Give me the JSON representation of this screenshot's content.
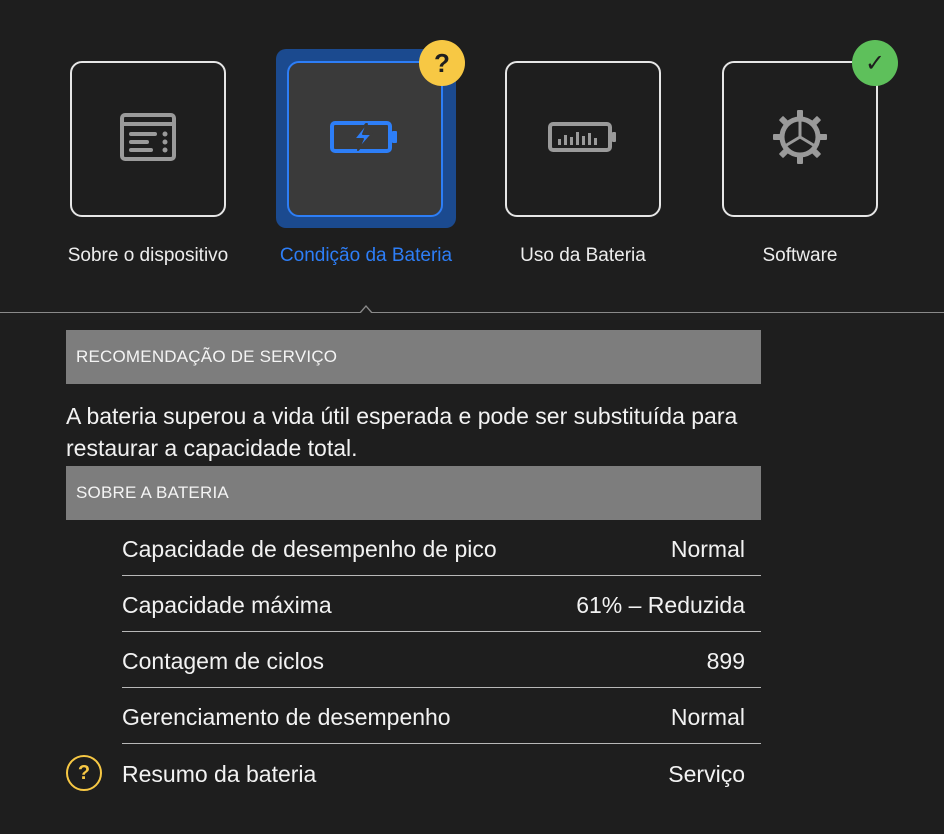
{
  "tabs": [
    {
      "label": "Sobre o dispositivo",
      "icon": "device-info-icon",
      "selected": false
    },
    {
      "label": "Condição da Bateria",
      "icon": "battery-charging-icon",
      "selected": true,
      "badge": "?"
    },
    {
      "label": "Uso da Bateria",
      "icon": "battery-usage-icon",
      "selected": false
    },
    {
      "label": "Software",
      "icon": "gear-icon",
      "selected": false,
      "badge": "✓"
    }
  ],
  "service_section": {
    "header": "RECOMENDAÇÃO DE SERVIÇO",
    "text": "A bateria superou a vida útil esperada e pode ser substituída para restaurar a capacidade total."
  },
  "battery_section": {
    "header": "SOBRE A BATERIA",
    "rows": [
      {
        "label": "Capacidade de desempenho de pico",
        "value": "Normal"
      },
      {
        "label": "Capacidade máxima",
        "value": "61% – Reduzida"
      },
      {
        "label": "Contagem de ciclos",
        "value": "899"
      },
      {
        "label": "Gerenciamento de desempenho",
        "value": "Normal"
      },
      {
        "label": "Resumo da bateria",
        "value": "Serviço",
        "icon": "?"
      }
    ]
  },
  "colors": {
    "accent": "#2d7ef7",
    "warning": "#f7c844",
    "success": "#5ec05b",
    "background": "#1e1e1e"
  }
}
